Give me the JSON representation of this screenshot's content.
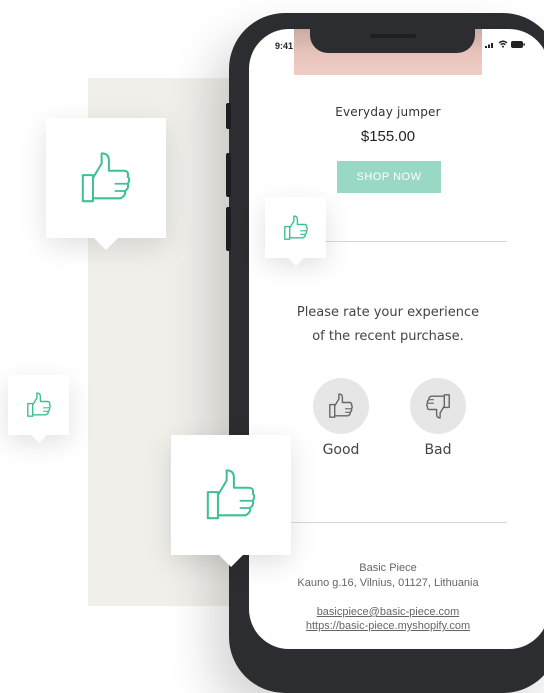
{
  "status_bar": {
    "time": "9:41"
  },
  "product": {
    "name": "Everyday jumper",
    "price": "$155.00",
    "cta_label": "SHOP NOW"
  },
  "rating": {
    "prompt_line1": "Please rate your experience",
    "prompt_line2": "of the recent purchase.",
    "good_label": "Good",
    "bad_label": "Bad"
  },
  "footer": {
    "store_name": "Basic Piece",
    "address": "Kauno g.16, Vilnius, 01127, Lithuania",
    "email": "basicpiece@basic-piece.com",
    "website": "https://basic-piece.myshopify.com"
  },
  "colors": {
    "accent": "#99d8c4",
    "thumb_icon": "#3fbf96",
    "backdrop": "#f1efea",
    "phone_frame": "#2b2d30"
  },
  "icons": [
    "thumbs-up-icon",
    "thumbs-down-icon",
    "signal-icon",
    "wifi-icon",
    "battery-icon"
  ]
}
